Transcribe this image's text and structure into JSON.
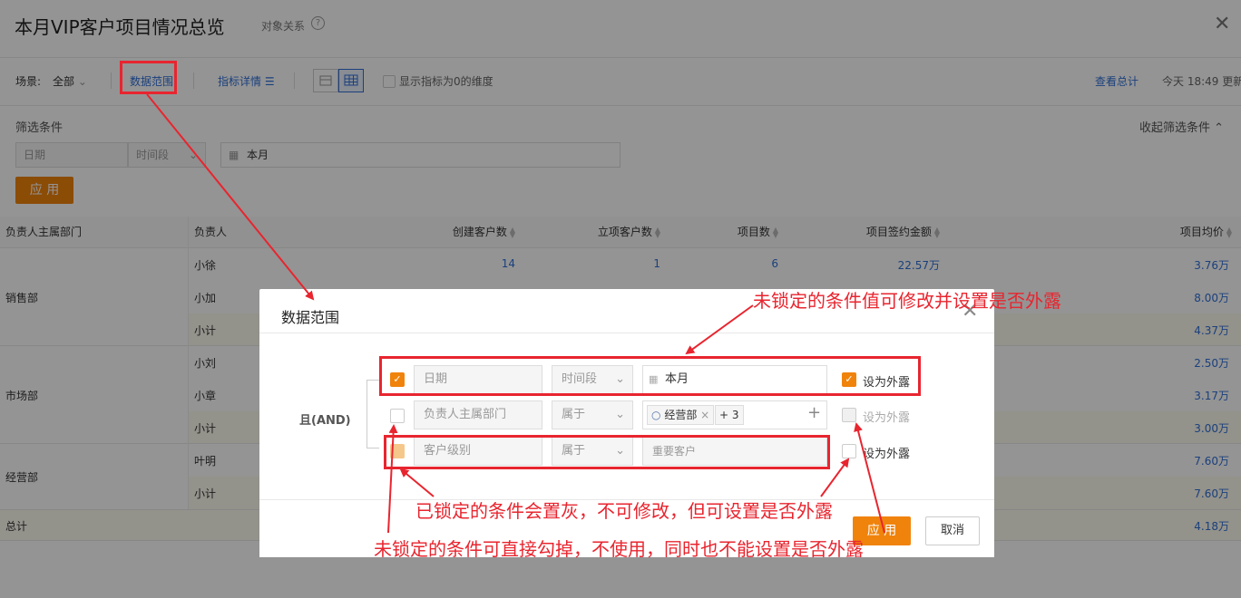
{
  "header": {
    "title": "本月VIP客户项目情况总览",
    "subtitle": "对象关系",
    "help": "?"
  },
  "toolbar": {
    "scene_label": "场景:",
    "scene_value": "全部",
    "data_range": "数据范围",
    "indicator_detail": "指标详情",
    "show_zero": "显示指标为0的维度",
    "view_total": "查看总计",
    "updated": "今天 18:49 更新"
  },
  "filters": {
    "title": "筛选条件",
    "collapse": "收起筛选条件",
    "field": "日期",
    "operator": "时间段",
    "value": "本月",
    "apply": "应 用"
  },
  "table": {
    "headers": [
      "负责人主属部门",
      "负责人",
      "创建客户数",
      "立项客户数",
      "项目数",
      "项目签约金额",
      "项目均价"
    ],
    "dept_sales": "销售部",
    "dept_market": "市场部",
    "dept_ops": "经营部",
    "r1": {
      "person": "小徐",
      "created": "14",
      "approved": "1",
      "projects": "6",
      "amount": "22.57万",
      "avg": "3.76万"
    },
    "r2": {
      "person": "小加",
      "avg": "8.00万"
    },
    "r3": {
      "person": "小计",
      "avg": "4.37万"
    },
    "r4": {
      "person": "小刘",
      "avg": "2.50万"
    },
    "r5": {
      "person": "小章",
      "avg": "3.17万"
    },
    "r6": {
      "person": "小计",
      "avg": "3.00万"
    },
    "r7": {
      "person": "叶明",
      "avg": "7.60万"
    },
    "r8": {
      "person": "小计",
      "avg": "7.60万"
    },
    "total": {
      "label": "总计",
      "avg": "4.18万"
    }
  },
  "modal": {
    "title": "数据范围",
    "and_label": "且(AND)",
    "row1": {
      "field": "日期",
      "operator": "时间段",
      "value": "本月",
      "expose": "设为外露"
    },
    "row2": {
      "field": "负责人主属部门",
      "operator": "属于",
      "tag": "经营部",
      "more": "+ 3",
      "expose": "设为外露"
    },
    "row3": {
      "field": "客户级别",
      "operator": "属于",
      "value": "重要客户",
      "expose": "设为外露"
    },
    "apply": "应 用",
    "cancel": "取消"
  },
  "annotations": {
    "top": "未锁定的条件值可修改并设置是否外露",
    "middle": "已锁定的条件会置灰，不可修改，但可设置是否外露",
    "bottom": "未锁定的条件可直接勾掉，不使用，同时也不能设置是否外露"
  },
  "colors": {
    "accent": "#f0830b",
    "link": "#2f6fd6",
    "annotation": "#e8252f"
  }
}
